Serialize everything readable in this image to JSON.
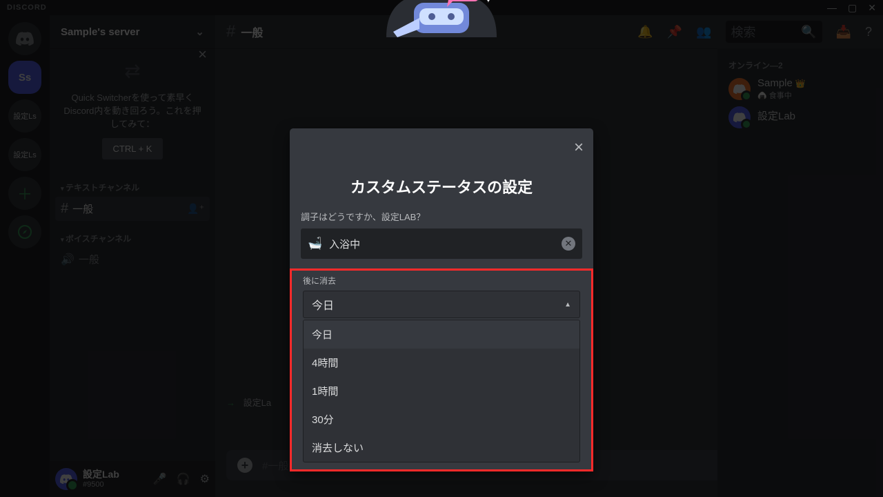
{
  "titlebar": {
    "brand": "DISCORD"
  },
  "guilds": {
    "selected_initials": "Ss",
    "g1": "設定Ls",
    "g2": "設定Ls"
  },
  "server": {
    "name": "Sample's server"
  },
  "quickswitch": {
    "text": "Quick Switcherを使って素早くDiscord内を動き回ろう。これを押してみて：",
    "button": "CTRL + K"
  },
  "categories": {
    "text": "テキストチャンネル",
    "voice": "ボイスチャンネル"
  },
  "channels": {
    "general": "一般",
    "voice_general": "一般"
  },
  "user": {
    "name": "設定Lab",
    "tag": "#9500"
  },
  "chat": {
    "channel": "一般",
    "search_placeholder": "検索",
    "typing_user": "設定La",
    "input_placeholder": "#一般へメッセージを送信"
  },
  "members": {
    "header": "オンライン—2",
    "m1_name": "Sample",
    "m1_status": "🍙 食事中",
    "m2_name": "設定Lab"
  },
  "modal": {
    "title": "カスタムステータスの設定",
    "prompt": "調子はどうですか、設定LAB？",
    "status_value": "入浴中",
    "clear_label": "後に消去",
    "selected": "今日",
    "options": [
      "今日",
      "4時間",
      "1時間",
      "30分",
      "消去しない"
    ]
  }
}
